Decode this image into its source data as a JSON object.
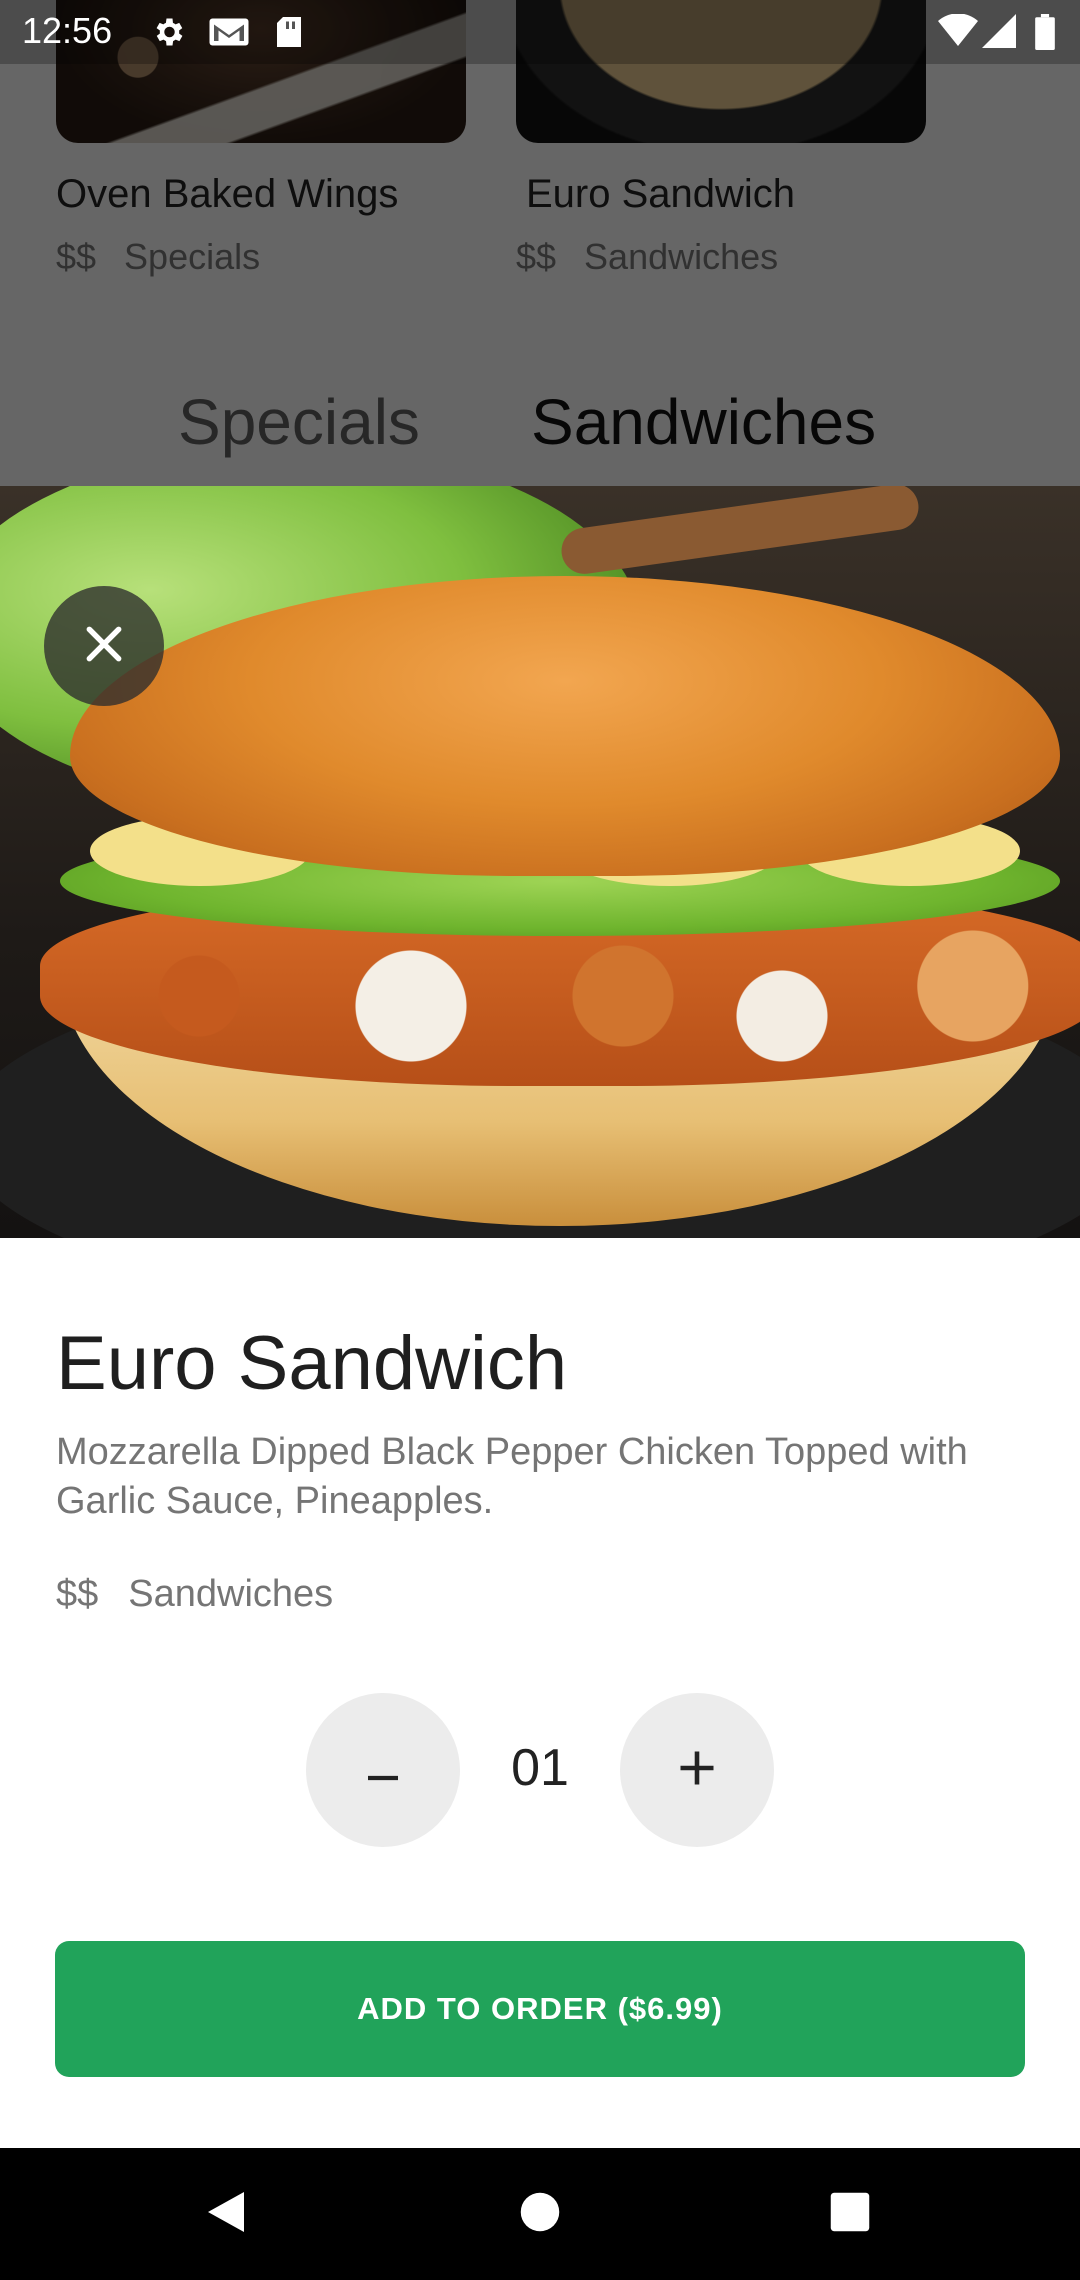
{
  "status_bar": {
    "time": "12:56",
    "icons": [
      "gear-icon",
      "gmail-icon",
      "sd-card-icon",
      "wifi-icon",
      "signal-icon",
      "battery-icon"
    ]
  },
  "background_list": {
    "cards": [
      {
        "title": "Oven Baked Wings",
        "price": "$$",
        "category": "Specials"
      },
      {
        "title": "Euro Sandwich",
        "price": "$$",
        "category": "Sandwiches"
      }
    ],
    "tabs": [
      {
        "label": "Specials",
        "active": false
      },
      {
        "label": "Sandwiches",
        "active": true
      }
    ]
  },
  "item": {
    "title": "Euro Sandwich",
    "description": "Mozzarella Dipped Black Pepper Chicken Topped with Garlic Sauce, Pineapples.",
    "price": "$$",
    "category": "Sandwiches"
  },
  "quantity": {
    "value": "01",
    "decrement_label": "–",
    "increment_label": "+"
  },
  "add_button": {
    "label": "ADD TO ORDER ($6.99)",
    "color": "#21a35a"
  },
  "nav_bar": {
    "icons": [
      "back-icon",
      "home-icon",
      "recents-icon"
    ]
  }
}
